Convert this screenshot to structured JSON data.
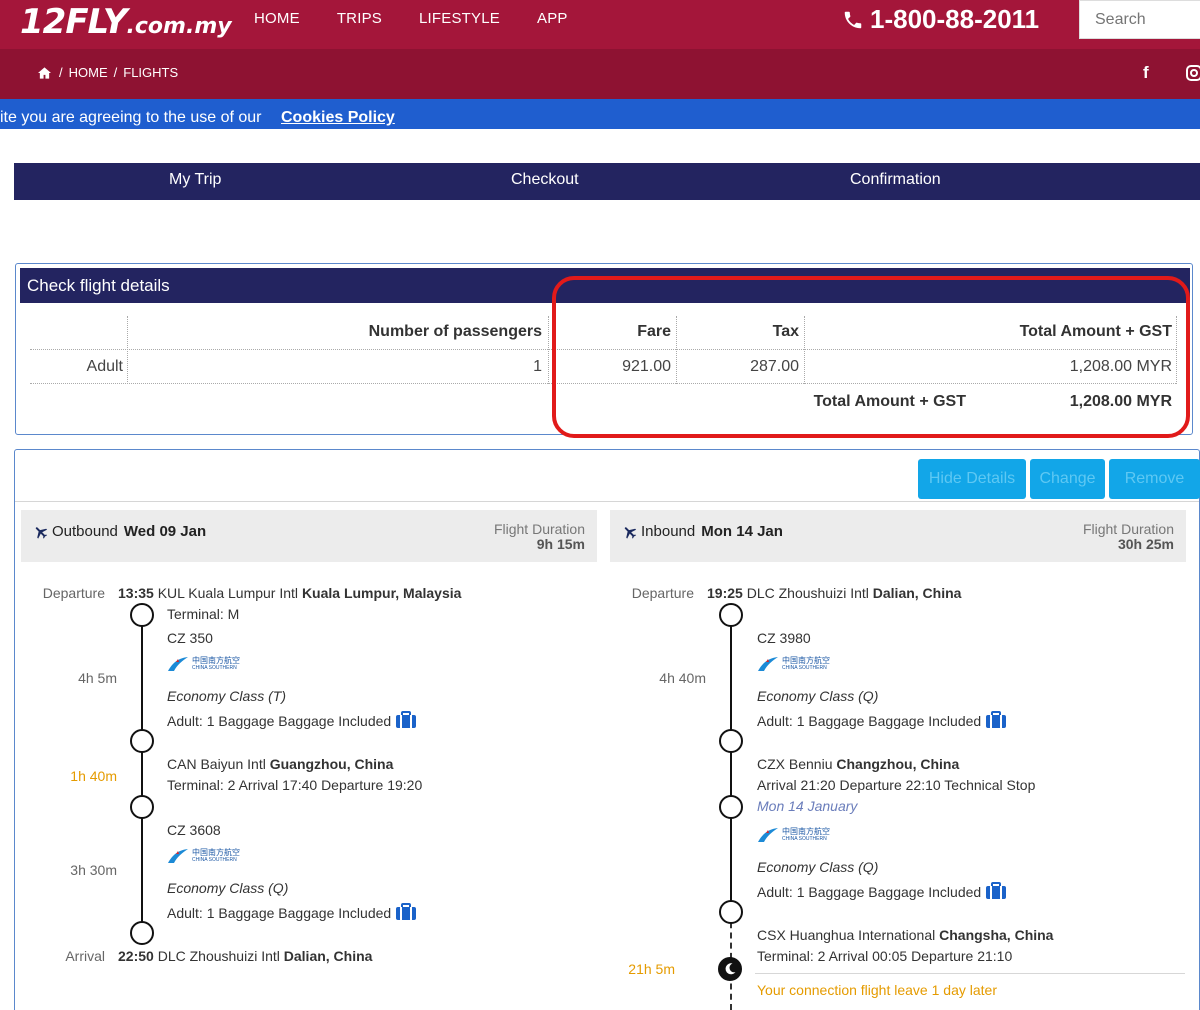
{
  "header": {
    "logo_main": "12FLY",
    "logo_suffix": ".com.my",
    "nav": [
      "HOME",
      "TRIPS",
      "LIFESTYLE",
      "APP"
    ],
    "phone": "1-800-88-2011",
    "search_placeholder": "Search"
  },
  "breadcrumb": {
    "home": "HOME",
    "sep": "/",
    "current": "FLIGHTS"
  },
  "cookie": {
    "text": "ite you are agreeing to the use of our",
    "link": "Cookies Policy"
  },
  "steps": [
    "My Trip",
    "Checkout",
    "Confirmation"
  ],
  "fare_panel": {
    "title": "Check flight details",
    "headers": {
      "passengers": "Number of passengers",
      "fare": "Fare",
      "tax": "Tax",
      "total": "Total Amount + GST"
    },
    "row": {
      "type": "Adult",
      "count": "1",
      "fare": "921.00",
      "tax": "287.00",
      "total": "1,208.00 MYR"
    },
    "grand_total_label": "Total Amount + GST",
    "grand_total_value": "1,208.00 MYR"
  },
  "actions": {
    "hide": "Hide Details",
    "change": "Change",
    "remove": "Remove"
  },
  "outbound": {
    "label": "Outbound",
    "date": "Wed 09 Jan",
    "duration_label": "Flight Duration",
    "duration": "9h 15m",
    "departure_label": "Departure",
    "dep_time": "13:35",
    "dep_airport": "KUL Kuala Lumpur Intl",
    "dep_city": "Kuala Lumpur, Malaysia",
    "dep_terminal": "Terminal: M",
    "seg1_flight": "CZ 350",
    "seg1_dur": "4h 5m",
    "seg1_class": "Economy Class (T)",
    "seg1_bag": "Adult: 1 Baggage Baggage Included",
    "stop_dur": "1h 40m",
    "stop_airport": "CAN Baiyun Intl",
    "stop_city": "Guangzhou, China",
    "stop_info": "Terminal: 2  Arrival 17:40 Departure 19:20",
    "seg2_flight": "CZ 3608",
    "seg2_dur": "3h 30m",
    "seg2_class": "Economy Class (Q)",
    "seg2_bag": "Adult: 1 Baggage Baggage Included",
    "arrival_label": "Arrival",
    "arr_time": "22:50",
    "arr_airport": "DLC Zhoushuizi Intl",
    "arr_city": "Dalian, China"
  },
  "inbound": {
    "label": "Inbound",
    "date": "Mon 14 Jan",
    "duration_label": "Flight Duration",
    "duration": "30h 25m",
    "departure_label": "Departure",
    "dep_time": "19:25",
    "dep_airport": "DLC Zhoushuizi Intl",
    "dep_city": "Dalian, China",
    "seg1_flight": "CZ 3980",
    "seg1_dur": "4h 40m",
    "seg1_class": "Economy Class (Q)",
    "seg1_bag": "Adult: 1 Baggage Baggage Included",
    "tech_airport": "CZX Benniu",
    "tech_city": "Changzhou, China",
    "tech_info": "Arrival 21:20 Departure 22:10 Technical Stop",
    "tech_date": "Mon 14 January",
    "seg2_class": "Economy Class (Q)",
    "seg2_bag": "Adult: 1 Baggage Baggage Included",
    "stop_airport": "CSX Huanghua International",
    "stop_city": "Changsha, China",
    "stop_info": "Terminal: 2  Arrival 00:05 Departure 21:10",
    "stop_dur": "21h 5m",
    "note": "Your connection flight leave 1 day later"
  },
  "airline": {
    "zh": "中国南方航空",
    "en": "CHINA SOUTHERN"
  },
  "colors": {
    "brand": "#a4163a",
    "navy": "#232460",
    "highlight": "#e11a1a",
    "accent": "#12a6e8",
    "stopover": "#e59b00"
  }
}
